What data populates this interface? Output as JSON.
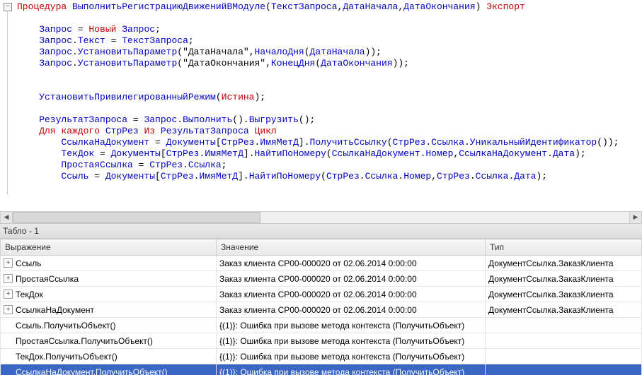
{
  "code": {
    "tokens": [
      [
        [
          "Процедура",
          "kw-red"
        ],
        [
          " ",
          "plain"
        ],
        [
          "ВыполнитьРегистрациюДвиженийВМодуле",
          "kw-blue"
        ],
        [
          "(",
          "plain"
        ],
        [
          "ТекстЗапроса",
          "kw-blue"
        ],
        [
          ",",
          "plain"
        ],
        [
          "ДатаНачала",
          "kw-blue"
        ],
        [
          ",",
          "plain"
        ],
        [
          "ДатаОкончания",
          "kw-blue"
        ],
        [
          ") ",
          "plain"
        ],
        [
          "Экспорт",
          "kw-red"
        ]
      ],
      [],
      [
        [
          "    Запрос",
          "kw-blue"
        ],
        [
          " = ",
          "plain"
        ],
        [
          "Новый",
          "kw-red"
        ],
        [
          " ",
          "plain"
        ],
        [
          "Запрос",
          "kw-blue"
        ],
        [
          ";",
          "plain"
        ]
      ],
      [
        [
          "    Запрос",
          "kw-blue"
        ],
        [
          ".",
          "plain"
        ],
        [
          "Текст",
          "kw-blue"
        ],
        [
          " = ",
          "plain"
        ],
        [
          "ТекстЗапроса",
          "kw-blue"
        ],
        [
          ";",
          "plain"
        ]
      ],
      [
        [
          "    Запрос",
          "kw-blue"
        ],
        [
          ".",
          "plain"
        ],
        [
          "УстановитьПараметр",
          "kw-blue"
        ],
        [
          "(",
          "plain"
        ],
        [
          "\"ДатаНачала\"",
          "str"
        ],
        [
          ",",
          "plain"
        ],
        [
          "НачалоДня",
          "kw-blue"
        ],
        [
          "(",
          "plain"
        ],
        [
          "ДатаНачала",
          "kw-blue"
        ],
        [
          "));",
          "plain"
        ]
      ],
      [
        [
          "    Запрос",
          "kw-blue"
        ],
        [
          ".",
          "plain"
        ],
        [
          "УстановитьПараметр",
          "kw-blue"
        ],
        [
          "(",
          "plain"
        ],
        [
          "\"ДатаОкончания\"",
          "str"
        ],
        [
          ",",
          "plain"
        ],
        [
          "КонецДня",
          "kw-blue"
        ],
        [
          "(",
          "plain"
        ],
        [
          "ДатаОкончания",
          "kw-blue"
        ],
        [
          "));",
          "plain"
        ]
      ],
      [],
      [],
      [
        [
          "    УстановитьПривилегированныйРежим",
          "kw-blue"
        ],
        [
          "(",
          "plain"
        ],
        [
          "Истина",
          "kw-red"
        ],
        [
          ");",
          "plain"
        ]
      ],
      [],
      [
        [
          "    РезультатЗапроса",
          "kw-blue"
        ],
        [
          " = ",
          "plain"
        ],
        [
          "Запрос",
          "kw-blue"
        ],
        [
          ".",
          "plain"
        ],
        [
          "Выполнить",
          "kw-blue"
        ],
        [
          "().",
          "plain"
        ],
        [
          "Выгрузить",
          "kw-blue"
        ],
        [
          "();",
          "plain"
        ]
      ],
      [
        [
          "    Для каждого",
          "kw-red"
        ],
        [
          " ",
          "plain"
        ],
        [
          "СтрРез",
          "kw-blue"
        ],
        [
          " ",
          "plain"
        ],
        [
          "Из",
          "kw-red"
        ],
        [
          " ",
          "plain"
        ],
        [
          "РезультатЗапроса",
          "kw-blue"
        ],
        [
          " ",
          "plain"
        ],
        [
          "Цикл",
          "kw-red"
        ]
      ],
      [
        [
          "        СсылкаНаДокумент",
          "kw-blue"
        ],
        [
          " = ",
          "plain"
        ],
        [
          "Документы",
          "kw-blue"
        ],
        [
          "[",
          "plain"
        ],
        [
          "СтрРез",
          "kw-blue"
        ],
        [
          ".",
          "plain"
        ],
        [
          "ИмяМетД",
          "kw-blue"
        ],
        [
          "].",
          "plain"
        ],
        [
          "ПолучитьСсылку",
          "kw-blue"
        ],
        [
          "(",
          "plain"
        ],
        [
          "СтрРез",
          "kw-blue"
        ],
        [
          ".",
          "plain"
        ],
        [
          "Ссылка",
          "kw-blue"
        ],
        [
          ".",
          "plain"
        ],
        [
          "УникальныйИдентификатор",
          "kw-blue"
        ],
        [
          "());",
          "plain"
        ]
      ],
      [
        [
          "        ТекДок",
          "kw-blue"
        ],
        [
          " = ",
          "plain"
        ],
        [
          "Документы",
          "kw-blue"
        ],
        [
          "[",
          "plain"
        ],
        [
          "СтрРез",
          "kw-blue"
        ],
        [
          ".",
          "plain"
        ],
        [
          "ИмяМетД",
          "kw-blue"
        ],
        [
          "].",
          "plain"
        ],
        [
          "НайтиПоНомеру",
          "kw-blue"
        ],
        [
          "(",
          "plain"
        ],
        [
          "СсылкаНаДокумент",
          "kw-blue"
        ],
        [
          ".",
          "plain"
        ],
        [
          "Номер",
          "kw-blue"
        ],
        [
          ",",
          "plain"
        ],
        [
          "СсылкаНаДокумент",
          "kw-blue"
        ],
        [
          ".",
          "plain"
        ],
        [
          "Дата",
          "kw-blue"
        ],
        [
          ");",
          "plain"
        ]
      ],
      [
        [
          "        ПростаяСсылка",
          "kw-blue"
        ],
        [
          " = ",
          "plain"
        ],
        [
          "СтрРез",
          "kw-blue"
        ],
        [
          ".",
          "plain"
        ],
        [
          "Ссылка",
          "kw-blue"
        ],
        [
          ";",
          "plain"
        ]
      ],
      [
        [
          "        Ссыль",
          "kw-blue"
        ],
        [
          " = ",
          "plain"
        ],
        [
          "Документы",
          "kw-blue"
        ],
        [
          "[",
          "plain"
        ],
        [
          "СтрРез",
          "kw-blue"
        ],
        [
          ".",
          "plain"
        ],
        [
          "ИмяМетД",
          "kw-blue"
        ],
        [
          "].",
          "plain"
        ],
        [
          "НайтиПоНомеру",
          "kw-blue"
        ],
        [
          "(",
          "plain"
        ],
        [
          "СтрРез",
          "kw-blue"
        ],
        [
          ".",
          "plain"
        ],
        [
          "Ссылка",
          "kw-blue"
        ],
        [
          ".",
          "plain"
        ],
        [
          "Номер",
          "kw-blue"
        ],
        [
          ",",
          "plain"
        ],
        [
          "СтрРез",
          "kw-blue"
        ],
        [
          ".",
          "plain"
        ],
        [
          "Ссылка",
          "kw-blue"
        ],
        [
          ".",
          "plain"
        ],
        [
          "Дата",
          "kw-blue"
        ],
        [
          ");",
          "plain"
        ]
      ]
    ]
  },
  "fold_glyph": "−",
  "scroll": {
    "left_glyph": "◀",
    "right_glyph": "▶"
  },
  "panel_title": "Табло - 1",
  "columns": {
    "expr": "Выражение",
    "value": "Значение",
    "type": "Тип"
  },
  "rows": [
    {
      "toggle": "+",
      "expr": "Ссыль",
      "value": "Заказ клиента СР00-000020 от 02.06.2014 0:00:00",
      "type": "ДокументСсылка.ЗаказКлиента",
      "selected": false
    },
    {
      "toggle": "+",
      "expr": "ПростаяСсылка",
      "value": "Заказ клиента СР00-000020 от 02.06.2014 0:00:00",
      "type": "ДокументСсылка.ЗаказКлиента",
      "selected": false
    },
    {
      "toggle": "+",
      "expr": "ТекДок",
      "value": "Заказ клиента СР00-000020 от 02.06.2014 0:00:00",
      "type": "ДокументСсылка.ЗаказКлиента",
      "selected": false
    },
    {
      "toggle": "+",
      "expr": "СсылкаНаДокумент",
      "value": "Заказ клиента СР00-000020 от 02.06.2014 0:00:00",
      "type": "ДокументСсылка.ЗаказКлиента",
      "selected": false
    },
    {
      "toggle": "",
      "expr": "Ссыль.ПолучитьОбъект()",
      "value": "{(1)}: Ошибка при вызове метода контекста (ПолучитьОбъект)",
      "type": "",
      "selected": false
    },
    {
      "toggle": "",
      "expr": "ПростаяСсылка.ПолучитьОбъект()",
      "value": "{(1)}: Ошибка при вызове метода контекста (ПолучитьОбъект)",
      "type": "",
      "selected": false
    },
    {
      "toggle": "",
      "expr": "ТекДок.ПолучитьОбъект()",
      "value": "{(1)}: Ошибка при вызове метода контекста (ПолучитьОбъект)",
      "type": "",
      "selected": false
    },
    {
      "toggle": "",
      "expr": "СсылкаНаДокумент.ПолучитьОбъект()",
      "value": "{(1)}: Ошибка при вызове метода контекста (ПолучитьОбъект)",
      "type": "",
      "selected": true
    }
  ]
}
